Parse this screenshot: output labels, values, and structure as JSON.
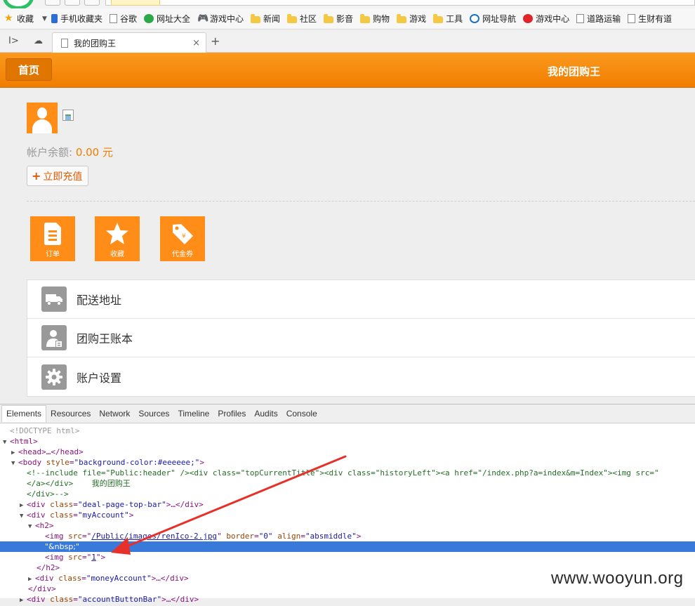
{
  "bookmarks_bar": {
    "items": [
      {
        "label": "收藏",
        "icon": "star-icon"
      },
      {
        "label": "手机收藏夹",
        "icon": "phone-icon"
      },
      {
        "label": "谷歌",
        "icon": "page-icon"
      },
      {
        "label": "网址大全",
        "icon": "globe-icon"
      },
      {
        "label": "游戏中心",
        "icon": "gamepad-icon"
      },
      {
        "label": "新闻",
        "icon": "folder-icon"
      },
      {
        "label": "社区",
        "icon": "folder-icon"
      },
      {
        "label": "影音",
        "icon": "folder-icon"
      },
      {
        "label": "购物",
        "icon": "folder-icon"
      },
      {
        "label": "游戏",
        "icon": "folder-icon"
      },
      {
        "label": "工具",
        "icon": "folder-icon"
      },
      {
        "label": "网址导航",
        "icon": "nav-icon"
      },
      {
        "label": "游戏中心",
        "icon": "red-circle-icon"
      },
      {
        "label": "道路运输",
        "icon": "page-icon"
      },
      {
        "label": "生财有道",
        "icon": "page-icon"
      }
    ]
  },
  "tab": {
    "title": "我的团购王",
    "close": "×",
    "new_tab": "+"
  },
  "header": {
    "home_label": "首页",
    "title": "我的团购王"
  },
  "account": {
    "balance_label": "帐户余额: ",
    "balance_value": "0.00",
    "balance_unit": " 元",
    "recharge_icon": "+",
    "recharge_label": "立即充值"
  },
  "tiles": [
    {
      "label": "订单",
      "icon": "order-icon"
    },
    {
      "label": "收藏",
      "icon": "star-icon"
    },
    {
      "label": "代金券",
      "icon": "coupon-icon"
    }
  ],
  "menu": [
    {
      "label": "配送地址",
      "icon": "truck-icon"
    },
    {
      "label": "团购王账本",
      "icon": "account-book-icon"
    },
    {
      "label": "账户设置",
      "icon": "gear-icon"
    }
  ],
  "devtools": {
    "tabs": [
      "Elements",
      "Resources",
      "Network",
      "Sources",
      "Timeline",
      "Profiles",
      "Audits",
      "Console"
    ],
    "active_tab": "Elements",
    "code": {
      "doctype": "<!DOCTYPE html>",
      "html_open": "<html>",
      "head": "<head>…</head>",
      "body_open_pre": "<body ",
      "body_attr": "style",
      "body_val": "\"background-color:#eeeeee;\"",
      "comment1": "<!--include file=\"Public:header\" /><div class=\"topCurrentTitle\"><div class=\"historyLeft\"><a href=\"/index.php?a=index&m=Index\"><img src=\"",
      "comment2a": "</a></div>",
      "comment2_text": "我的团购王",
      "comment3": "</div>-->",
      "div1_pre": "<div ",
      "div1_attr": "class",
      "div1_val": "\"deal-page-top-bar\"",
      "div1_post": ">…</div>",
      "div2_val": "\"myAccount\"",
      "div2_post": ">",
      "h2_open": "<h2>",
      "img1_pre": "<img ",
      "img1_src_attr": "src",
      "img1_src_val": "/Public/images/renIco-2.jpg",
      "img1_border_attr": "border",
      "img1_border_val": "\"0\"",
      "img1_align_attr": "align",
      "img1_align_val": "\"absmiddle\"",
      "img1_post": ">",
      "nbsp_text": "\"&nbsp;\"",
      "img2_src_val": "1",
      "img2_post": ">",
      "h2_close": "</h2>",
      "div3_val": "\"moneyAccount\"",
      "div3_post": ">…</div>",
      "div_close": "</div>",
      "div4_val": "\"accountButtonBar\"",
      "div4_post": ">…</div>"
    }
  },
  "watermark": "www.wooyun.org",
  "colors": {
    "accent": "#f07d00",
    "selection": "#3879d9",
    "arrow": "#e8302a"
  }
}
